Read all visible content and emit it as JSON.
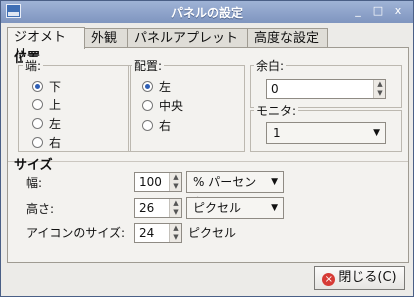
{
  "window": {
    "title": "パネルの設定",
    "buttons": {
      "minimize": "_",
      "maximize": "□",
      "close": "x"
    }
  },
  "tabs": [
    {
      "label": "ジオメトリ",
      "active": true
    },
    {
      "label": "外観",
      "active": false
    },
    {
      "label": "パネルアプレット",
      "active": false
    },
    {
      "label": "高度な設定",
      "active": false
    }
  ],
  "position_section": {
    "title": "位置",
    "edge": {
      "label": "端:",
      "options": [
        "下",
        "上",
        "左",
        "右"
      ],
      "selected": "下"
    },
    "alignment": {
      "label": "配置:",
      "options": [
        "左",
        "中央",
        "右"
      ],
      "selected": "左"
    },
    "margin": {
      "label": "余白:",
      "value": "0"
    },
    "monitor": {
      "label": "モニタ:",
      "value": "1"
    }
  },
  "size_section": {
    "title": "サイズ",
    "width": {
      "label": "幅:",
      "value": "100",
      "unit": "% パーセント"
    },
    "height": {
      "label": "高さ:",
      "value": "26",
      "unit": "ピクセル"
    },
    "icon_size": {
      "label": "アイコンのサイズ:",
      "value": "24",
      "unit": "ピクセル"
    }
  },
  "footer": {
    "close_button": "閉じる(C)"
  }
}
